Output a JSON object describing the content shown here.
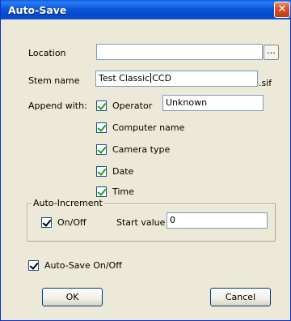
{
  "window": {
    "title": "Auto-Save",
    "close_glyph": "✕"
  },
  "location": {
    "label": "Location",
    "value": "",
    "browse_label": "..."
  },
  "stem": {
    "label": "Stem name",
    "value_before_caret": "Test Classic",
    "value_after_caret": "CCD",
    "extension": ".sif"
  },
  "append": {
    "label": "Append with:",
    "options": [
      {
        "label": "Operator",
        "checked": true
      },
      {
        "label": "Computer name",
        "checked": true
      },
      {
        "label": "Camera type",
        "checked": true
      },
      {
        "label": "Date",
        "checked": true
      },
      {
        "label": "Time",
        "checked": true
      }
    ],
    "operator_value": "Unknown"
  },
  "auto_increment": {
    "title": "Auto-Increment",
    "onoff_label": "On/Off",
    "onoff_checked": true,
    "start_label": "Start value",
    "start_value": "0"
  },
  "autosave": {
    "label": "Auto-Save On/Off",
    "checked": true
  },
  "buttons": {
    "ok": "OK",
    "cancel": "Cancel"
  },
  "colors": {
    "titlebar": "#0b57d8",
    "dialog_bg": "#ece9d8",
    "checkmark": "#21a121"
  }
}
